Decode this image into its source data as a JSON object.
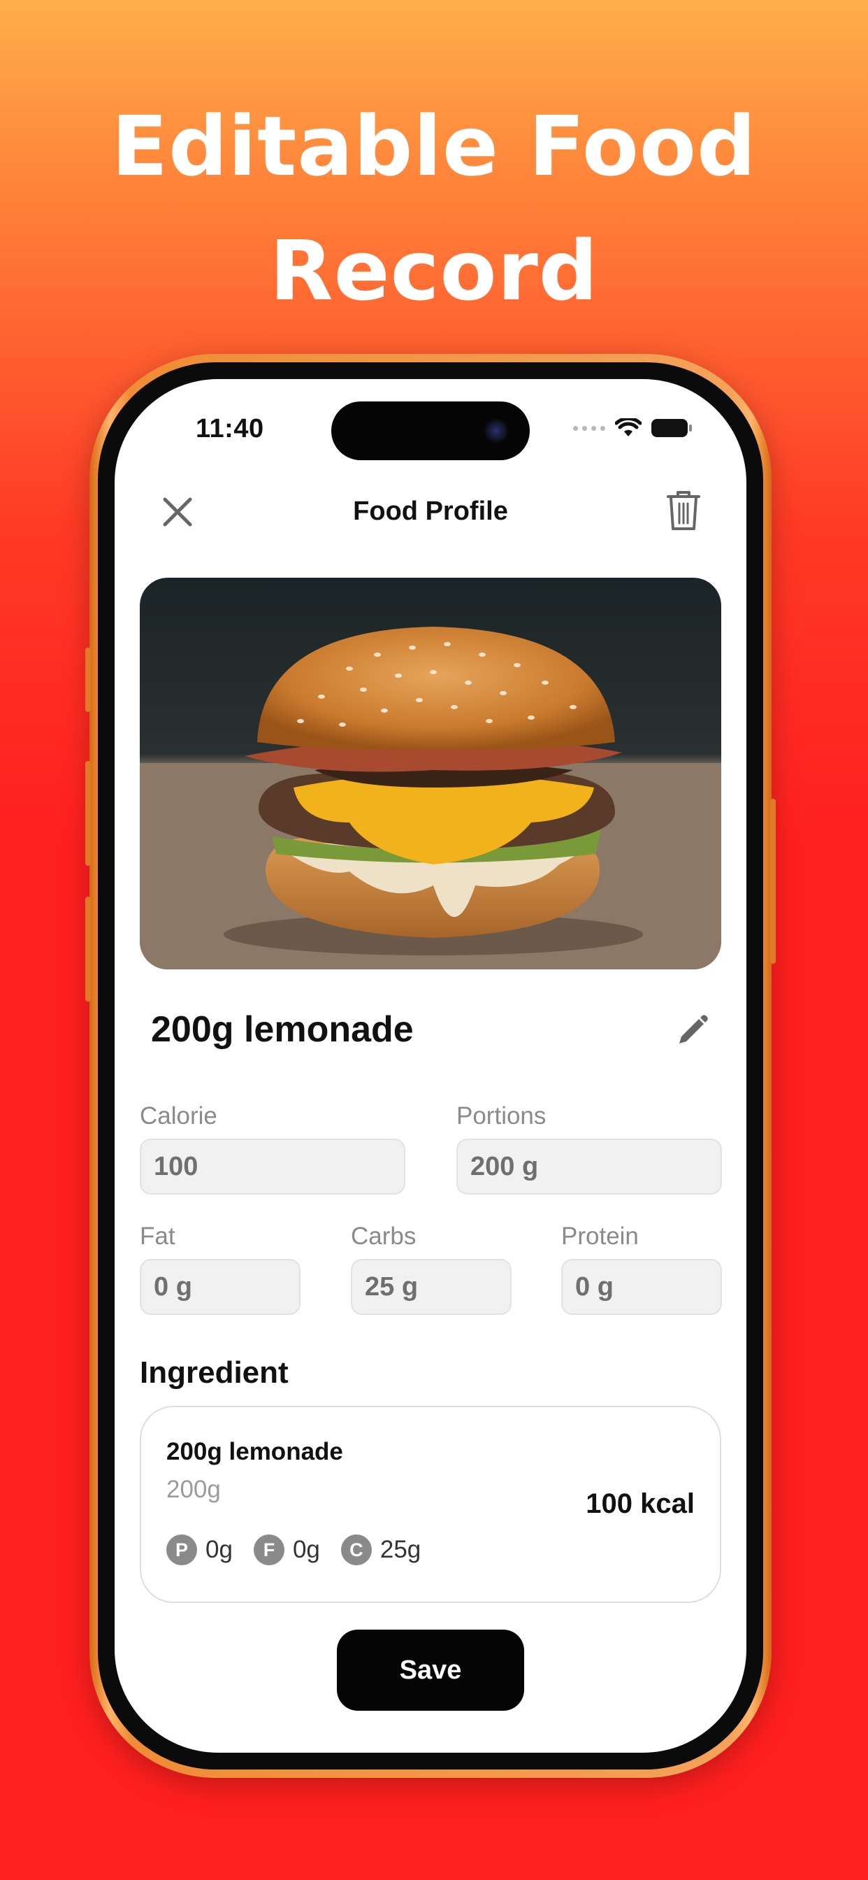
{
  "headline": {
    "line1": "Editable Food",
    "line2": "Record"
  },
  "status_bar": {
    "time": "11:40"
  },
  "nav": {
    "title": "Food Profile",
    "close_icon": "close-icon",
    "delete_icon": "trash-icon"
  },
  "food": {
    "photo_icon": "burger-photo",
    "name": "200g lemonade",
    "edit_icon": "pencil-icon"
  },
  "fields": {
    "calorie": {
      "label": "Calorie",
      "value": "100"
    },
    "portions": {
      "label": "Portions",
      "value": "200 g"
    },
    "fat": {
      "label": "Fat",
      "value": "0 g"
    },
    "carbs": {
      "label": "Carbs",
      "value": "25 g"
    },
    "protein": {
      "label": "Protein",
      "value": "0 g"
    }
  },
  "ingredient": {
    "section_title": "Ingredient",
    "name": "200g lemonade",
    "amount": "200g",
    "kcal": "100 kcal",
    "macros": [
      {
        "badge": "P",
        "value": "0g"
      },
      {
        "badge": "F",
        "value": "0g"
      },
      {
        "badge": "C",
        "value": "25g"
      }
    ]
  },
  "save_label": "Save",
  "colors": {
    "gradient_top": "#ffae4a",
    "gradient_bottom": "#ff1f1f",
    "phone_frame": "#f08c35",
    "button": "#050505"
  }
}
